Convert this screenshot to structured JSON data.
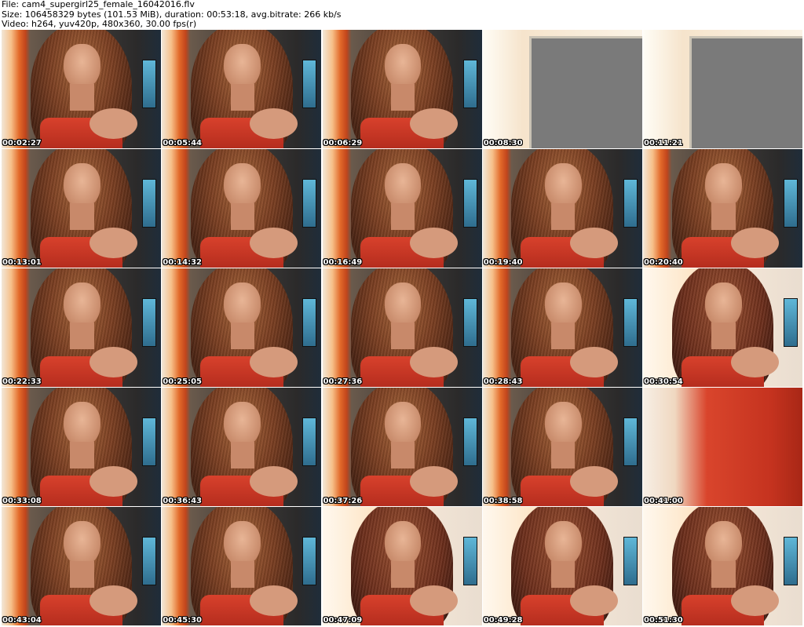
{
  "header": {
    "file_line": "File: cam4_supergirl25_female_16042016.flv",
    "size_line": "Size: 106458329 bytes (101.53 MiB), duration: 00:53:18, avg.bitrate: 266 kb/s",
    "video_line": "Video: h264, yuv420p, 480x360, 30.00 fps(r)"
  },
  "thumbnails": [
    {
      "time": "00:02:27",
      "scene": "webcam"
    },
    {
      "time": "00:05:44",
      "scene": "webcam"
    },
    {
      "time": "00:06:29",
      "scene": "webcam"
    },
    {
      "time": "00:08:30",
      "scene": "gray"
    },
    {
      "time": "00:11:21",
      "scene": "gray"
    },
    {
      "time": "00:13:01",
      "scene": "webcam"
    },
    {
      "time": "00:14:32",
      "scene": "webcam"
    },
    {
      "time": "00:16:49",
      "scene": "webcam"
    },
    {
      "time": "00:19:40",
      "scene": "webcam"
    },
    {
      "time": "00:20:40",
      "scene": "webcam"
    },
    {
      "time": "00:22:33",
      "scene": "webcam"
    },
    {
      "time": "00:25:05",
      "scene": "webcam"
    },
    {
      "time": "00:27:36",
      "scene": "webcam"
    },
    {
      "time": "00:28:43",
      "scene": "webcam"
    },
    {
      "time": "00:30:54",
      "scene": "bright"
    },
    {
      "time": "00:33:08",
      "scene": "webcam"
    },
    {
      "time": "00:36:43",
      "scene": "webcam"
    },
    {
      "time": "00:37:26",
      "scene": "webcam"
    },
    {
      "time": "00:38:58",
      "scene": "webcam"
    },
    {
      "time": "00:41:00",
      "scene": "red"
    },
    {
      "time": "00:43:04",
      "scene": "webcam"
    },
    {
      "time": "00:45:30",
      "scene": "webcam"
    },
    {
      "time": "00:47:09",
      "scene": "bright"
    },
    {
      "time": "00:49:28",
      "scene": "bright"
    },
    {
      "time": "00:51:30",
      "scene": "bright"
    }
  ]
}
